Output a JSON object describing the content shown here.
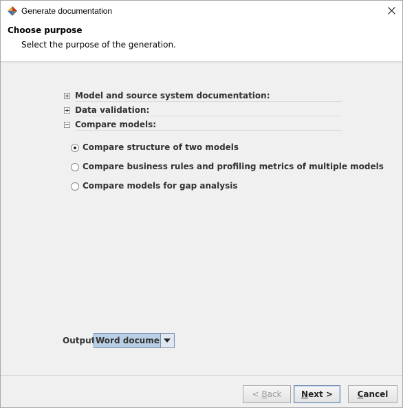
{
  "window": {
    "title": "Generate documentation"
  },
  "header": {
    "title": "Choose purpose",
    "subtitle": "Select the purpose of the generation."
  },
  "tree": {
    "items": [
      {
        "label": "Model and source system documentation:",
        "expanded": false
      },
      {
        "label": "Data validation:",
        "expanded": false
      },
      {
        "label": "Compare models:",
        "expanded": true
      }
    ]
  },
  "options": {
    "items": [
      {
        "label": "Compare structure of two models",
        "checked": true
      },
      {
        "label": "Compare business rules and profiling metrics of multiple models",
        "checked": false
      },
      {
        "label": "Compare models for gap analysis",
        "checked": false
      }
    ]
  },
  "output": {
    "label": "Output:",
    "value": "Word document"
  },
  "buttons": {
    "back": {
      "prefix": "< ",
      "mnemonic": "B",
      "rest": "ack"
    },
    "next": {
      "mnemonic": "N",
      "rest": "ext >"
    },
    "cancel": {
      "mnemonic": "C",
      "rest": "ancel"
    }
  }
}
